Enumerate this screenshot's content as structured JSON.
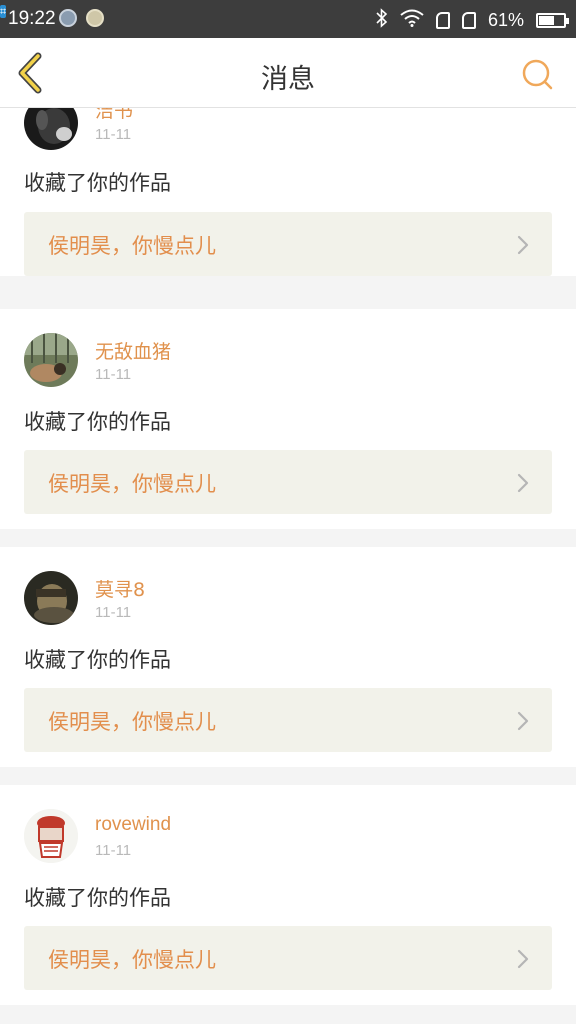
{
  "status_bar": {
    "time": "19:22",
    "battery_text": "61%",
    "battery_level": 0.61,
    "icons": [
      "app-notification-icon",
      "app-notification-icon",
      "scan-app-icon",
      "bluetooth-icon",
      "wifi-icon",
      "sim-card-icon",
      "sim-card-icon",
      "battery-icon"
    ]
  },
  "nav": {
    "title": "消息",
    "back_icon": "back-chevron-icon",
    "search_icon": "search-icon",
    "accent_color": "#f0a85a"
  },
  "messages": [
    {
      "user": "洁书",
      "date": "11-11",
      "action": "收藏了你的作品",
      "work": "侯明昊，你慢点儿"
    },
    {
      "user": "无敌血猪",
      "date": "11-11",
      "action": "收藏了你的作品",
      "work": "侯明昊，你慢点儿"
    },
    {
      "user": "莫寻8",
      "date": "11-11",
      "action": "收藏了你的作品",
      "work": "侯明昊，你慢点儿"
    },
    {
      "user": "rovewind",
      "date": "11-11",
      "action": "收藏了你的作品",
      "work": "侯明昊，你慢点儿"
    }
  ],
  "colors": {
    "username": "#e0924d",
    "work_title": "#e28e4c",
    "work_bg": "#f2f2ea",
    "status_bar_bg": "#3d3d3d"
  }
}
